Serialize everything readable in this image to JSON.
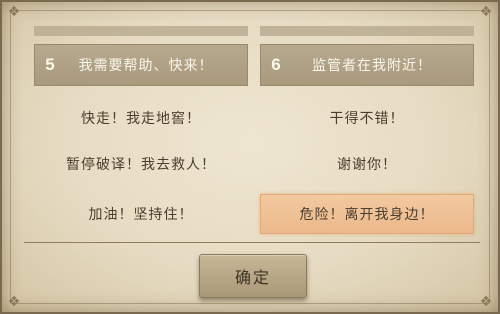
{
  "header": {
    "left": {
      "number": "5",
      "text": "我需要帮助、快来！"
    },
    "right": {
      "number": "6",
      "text": "监管者在我附近！"
    }
  },
  "options": [
    {
      "text": "快走！我走地窖！"
    },
    {
      "text": "干得不错！"
    },
    {
      "text": "暂停破译！我去救人！"
    },
    {
      "text": "谢谢你！"
    },
    {
      "text": "加油！坚持住！"
    },
    {
      "text": "危险！离开我身边！",
      "selected": true
    }
  ],
  "confirm_label": "确定",
  "colors": {
    "panel": "#e8dec7",
    "header": "#b0a185",
    "highlight": "#efbf92",
    "text": "#4a3e2e"
  }
}
